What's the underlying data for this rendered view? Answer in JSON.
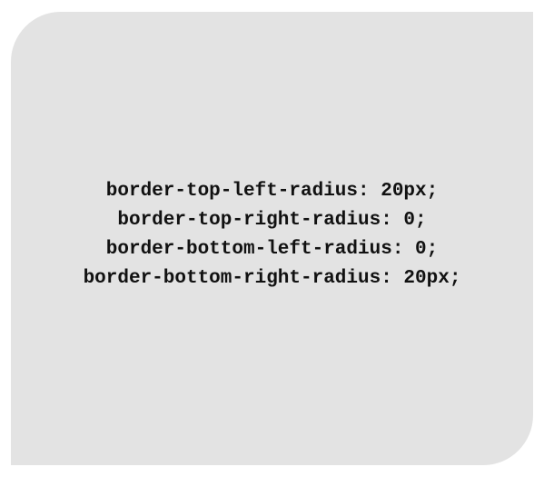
{
  "demo": {
    "background_color": "#e3e3e3",
    "text_color": "#111111",
    "lines": [
      "border-top-left-radius: 20px;",
      "border-top-right-radius: 0;",
      "border-bottom-left-radius: 0;",
      "border-bottom-right-radius: 20px;"
    ]
  }
}
